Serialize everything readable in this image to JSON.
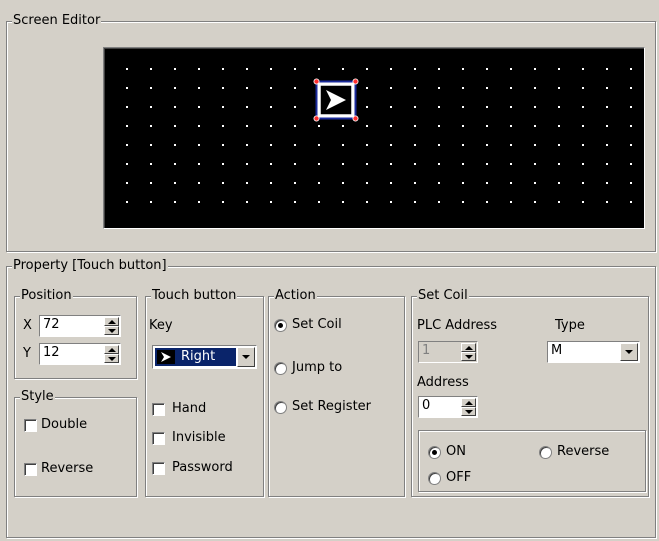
{
  "screen_editor": {
    "title": "Screen Editor",
    "canvas_color": "#000000",
    "grid_color": "#ffffff"
  },
  "property": {
    "title": "Property  [Touch button]",
    "position": {
      "title": "Position",
      "x_label": "X",
      "x_value": "72",
      "y_label": "Y",
      "y_value": "12"
    },
    "style": {
      "title": "Style",
      "double_label": "Double",
      "reverse_label": "Reverse"
    },
    "touch_button": {
      "title": "Touch button",
      "key_label": "Key",
      "key_value": "Right",
      "hand_label": "Hand",
      "invisible_label": "Invisible",
      "password_label": "Password"
    },
    "action": {
      "title": "Action",
      "options": [
        "Set Coil",
        "Jump to",
        "Set Register"
      ],
      "selected": "Set Coil"
    },
    "set_coil": {
      "title": "Set Coil",
      "plc_address_label": "PLC Address",
      "plc_address_value": "1",
      "type_label": "Type",
      "type_value": "M",
      "address_label": "Address",
      "address_value": "0",
      "on_label": "ON",
      "reverse_label": "Reverse",
      "off_label": "OFF",
      "selected": "ON"
    }
  }
}
